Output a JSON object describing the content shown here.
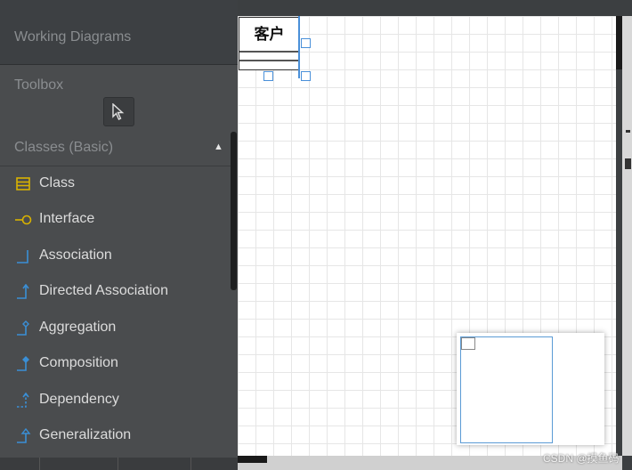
{
  "sidebar": {
    "working_diagrams": "Working Diagrams",
    "toolbox": "Toolbox",
    "classes_section": "Classes (Basic)",
    "pointer_icon": "pointer-arrow",
    "items": [
      {
        "label": "Class",
        "icon": "class-icon"
      },
      {
        "label": "Interface",
        "icon": "interface-icon"
      },
      {
        "label": "Association",
        "icon": "association-icon"
      },
      {
        "label": "Directed Association",
        "icon": "directed-association-icon"
      },
      {
        "label": "Aggregation",
        "icon": "aggregation-icon"
      },
      {
        "label": "Composition",
        "icon": "composition-icon"
      },
      {
        "label": "Dependency",
        "icon": "dependency-icon"
      },
      {
        "label": "Generalization",
        "icon": "generalization-icon"
      }
    ]
  },
  "canvas": {
    "class_name": "客户"
  },
  "watermark": "CSDN @摸鱼码",
  "colors": {
    "sidebar_bg": "#4a4c4e",
    "selection_blue": "#4a90d9",
    "class_icon_yellow": "#d9b200",
    "relation_icon_blue": "#3a8fd6"
  }
}
